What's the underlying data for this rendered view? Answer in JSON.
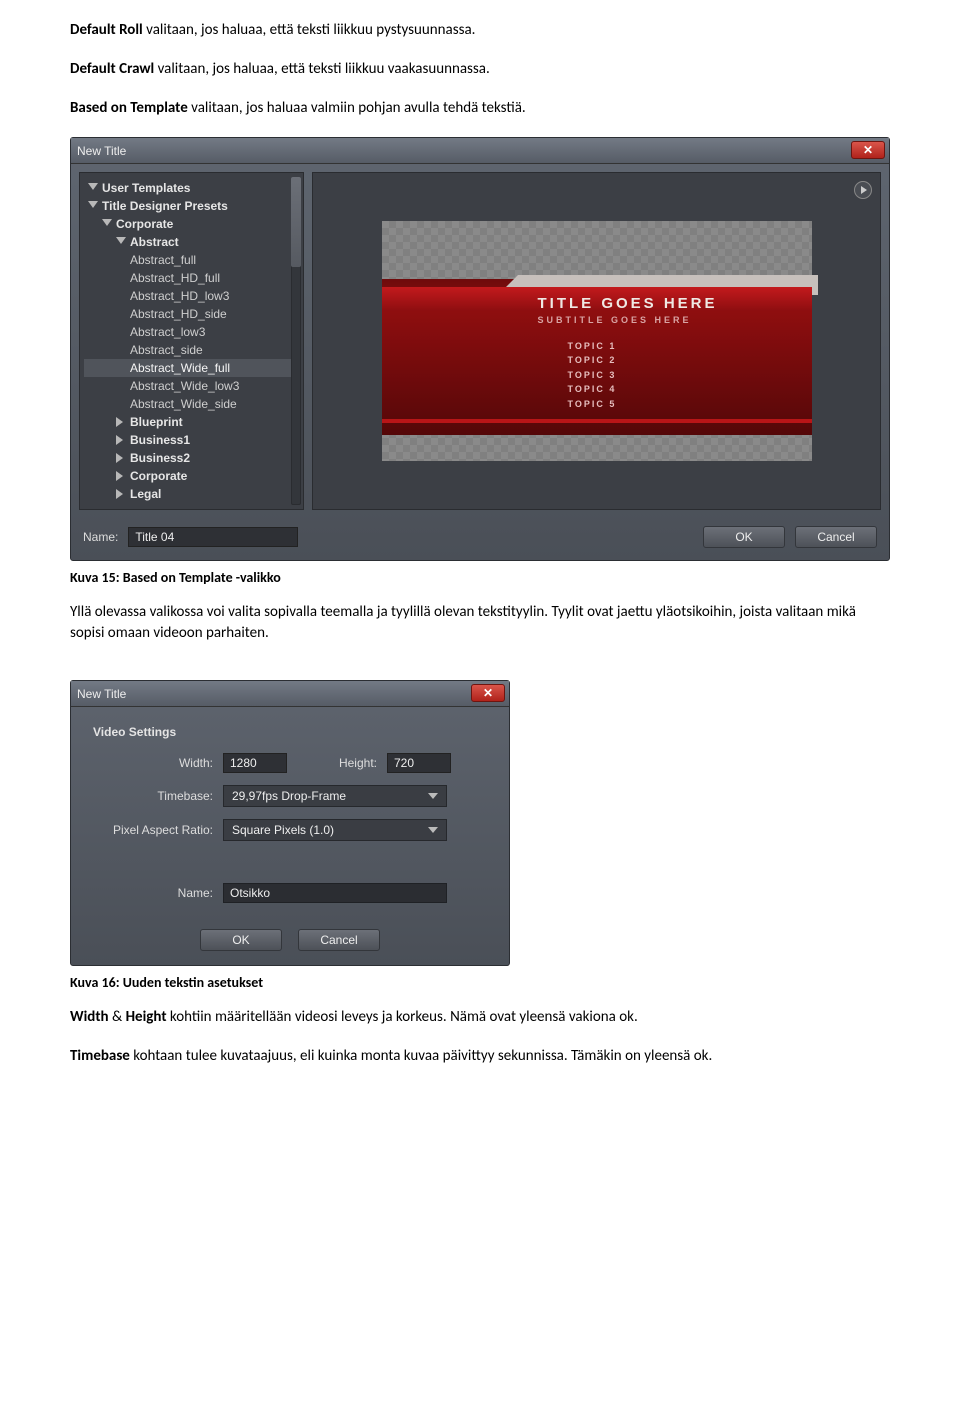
{
  "paragraphs": {
    "p1_bold": "Default Roll",
    "p1_rest": " valitaan, jos haluaa, että teksti liikkuu pystysuunnassa.",
    "p2_bold": "Default Crawl",
    "p2_rest": " valitaan, jos haluaa, että teksti liikkuu vaakasuunnassa.",
    "p3_bold": "Based on Template",
    "p3_rest": " valitaan, jos haluaa valmiin pohjan avulla tehdä tekstiä.",
    "caption1": "Kuva 15: Based on Template -valikko",
    "p4": "Yllä olevassa valikossa voi valita sopivalla teemalla ja tyylillä olevan tekstityylin. Tyylit ovat jaettu yläotsikoihin, joista valitaan mikä sopisi omaan videoon parhaiten.",
    "caption2": "Kuva 16: Uuden tekstin asetukset",
    "p5a_bold": "Width",
    "p5amp": " & ",
    "p5b_bold": "Height",
    "p5_rest": " kohtiin määritellään videosi leveys ja korkeus. Nämä ovat yleensä vakiona ok.",
    "p6_bold": "Timebase",
    "p6_rest": " kohtaan tulee kuvataajuus, eli kuinka monta kuvaa päivittyy sekunnissa. Tämäkin on yleensä ok."
  },
  "shot1": {
    "window_title": "New Title",
    "tree": {
      "user_templates": "User Templates",
      "presets": "Title Designer Presets",
      "corporate": "Corporate",
      "abstract": "Abstract",
      "items": [
        "Abstract_full",
        "Abstract_HD_full",
        "Abstract_HD_low3",
        "Abstract_HD_side",
        "Abstract_low3",
        "Abstract_side",
        "Abstract_Wide_full",
        "Abstract_Wide_low3",
        "Abstract_Wide_side"
      ],
      "folders": [
        "Blueprint",
        "Business1",
        "Business2",
        "Corporate",
        "Legal"
      ]
    },
    "preview": {
      "title": "TITLE GOES HERE",
      "subtitle": "SUBTITLE GOES HERE",
      "topics": [
        "TOPIC 1",
        "TOPIC 2",
        "TOPIC 3",
        "TOPIC 4",
        "TOPIC 5"
      ]
    },
    "name_label": "Name:",
    "name_value": "Title 04",
    "ok": "OK",
    "cancel": "Cancel"
  },
  "shot2": {
    "window_title": "New Title",
    "section": "Video Settings",
    "width_label": "Width:",
    "width_value": "1280",
    "height_label": "Height:",
    "height_value": "720",
    "timebase_label": "Timebase:",
    "timebase_value": "29,97fps Drop-Frame",
    "par_label": "Pixel Aspect Ratio:",
    "par_value": "Square Pixels (1.0)",
    "name_label": "Name:",
    "name_value": "Otsikko",
    "ok": "OK",
    "cancel": "Cancel"
  }
}
